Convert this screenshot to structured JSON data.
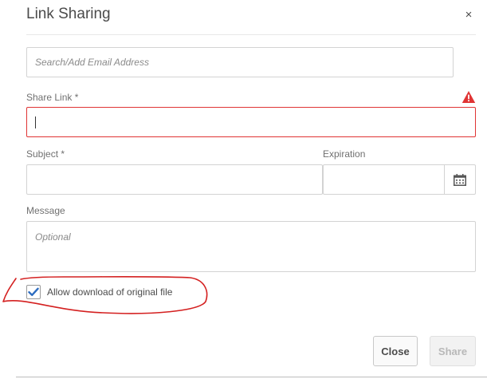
{
  "dialog": {
    "title": "Link Sharing",
    "close_glyph": "×"
  },
  "fields": {
    "search": {
      "placeholder": "Search/Add Email Address",
      "value": ""
    },
    "share_link": {
      "label": "Share Link *",
      "value": "",
      "state": "error",
      "error_icon": "warning-icon"
    },
    "subject": {
      "label": "Subject *",
      "value": ""
    },
    "expiration": {
      "label": "Expiration",
      "value": "",
      "button_icon": "calendar-icon"
    },
    "message": {
      "label": "Message",
      "placeholder": "Optional",
      "value": ""
    }
  },
  "download_option": {
    "label": "Allow download of original file",
    "checked": true
  },
  "buttons": {
    "close": "Close",
    "share": "Share",
    "share_enabled": false
  },
  "colors": {
    "error": "#e03434",
    "check": "#2d6cc0",
    "annotation": "#d42020"
  }
}
